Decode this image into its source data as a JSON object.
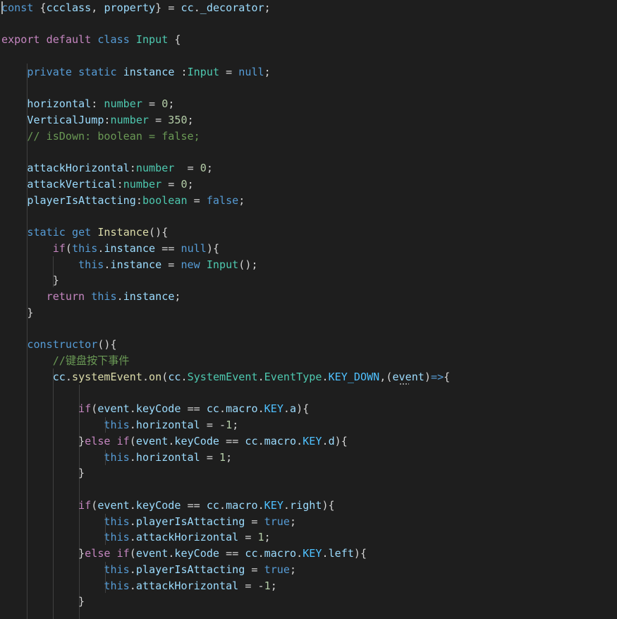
{
  "editor": {
    "language": "typescript",
    "theme": {
      "background": "#1e1e1e",
      "keyword": "#569cd6",
      "control": "#c586c0",
      "variable": "#9cdcfe",
      "type": "#4ec9b0",
      "function": "#dcdcaa",
      "number": "#b5cea8",
      "comment": "#6a9955",
      "plain": "#d4d4d4"
    },
    "lines": [
      [
        [
          "kw",
          "const"
        ],
        [
          "p",
          " {"
        ],
        [
          "v",
          "ccclass"
        ],
        [
          "p",
          ", "
        ],
        [
          "v",
          "property"
        ],
        [
          "p",
          "} = "
        ],
        [
          "v",
          "cc"
        ],
        [
          "p",
          "."
        ],
        [
          "v",
          "_decorator"
        ],
        [
          "p",
          ";"
        ]
      ],
      [],
      [
        [
          "ctl",
          "export"
        ],
        [
          "p",
          " "
        ],
        [
          "ctl",
          "default"
        ],
        [
          "p",
          " "
        ],
        [
          "kw",
          "class"
        ],
        [
          "p",
          " "
        ],
        [
          "t",
          "Input"
        ],
        [
          "p",
          " {"
        ]
      ],
      [],
      [
        [
          "p",
          "    "
        ],
        [
          "kw",
          "private"
        ],
        [
          "p",
          " "
        ],
        [
          "kw",
          "static"
        ],
        [
          "p",
          " "
        ],
        [
          "v",
          "instance"
        ],
        [
          "p",
          " :"
        ],
        [
          "t",
          "Input"
        ],
        [
          "p",
          " = "
        ],
        [
          "kw",
          "null"
        ],
        [
          "p",
          ";"
        ]
      ],
      [],
      [
        [
          "p",
          "    "
        ],
        [
          "v",
          "horizontal"
        ],
        [
          "p",
          ": "
        ],
        [
          "t",
          "number"
        ],
        [
          "p",
          " = "
        ],
        [
          "n",
          "0"
        ],
        [
          "p",
          ";"
        ]
      ],
      [
        [
          "p",
          "    "
        ],
        [
          "v",
          "VerticalJump"
        ],
        [
          "p",
          ":"
        ],
        [
          "t",
          "number"
        ],
        [
          "p",
          " = "
        ],
        [
          "n",
          "350"
        ],
        [
          "p",
          ";"
        ]
      ],
      [
        [
          "p",
          "    "
        ],
        [
          "c",
          "// isDown: boolean = false;"
        ]
      ],
      [],
      [
        [
          "p",
          "    "
        ],
        [
          "v",
          "attackHorizontal"
        ],
        [
          "p",
          ":"
        ],
        [
          "t",
          "number"
        ],
        [
          "p",
          "  = "
        ],
        [
          "n",
          "0"
        ],
        [
          "p",
          ";"
        ]
      ],
      [
        [
          "p",
          "    "
        ],
        [
          "v",
          "attackVertical"
        ],
        [
          "p",
          ":"
        ],
        [
          "t",
          "number"
        ],
        [
          "p",
          " = "
        ],
        [
          "n",
          "0"
        ],
        [
          "p",
          ";"
        ]
      ],
      [
        [
          "p",
          "    "
        ],
        [
          "v",
          "playerIsAttacting"
        ],
        [
          "p",
          ":"
        ],
        [
          "t",
          "boolean"
        ],
        [
          "p",
          " = "
        ],
        [
          "kw",
          "false"
        ],
        [
          "p",
          ";"
        ]
      ],
      [],
      [
        [
          "p",
          "    "
        ],
        [
          "kw",
          "static"
        ],
        [
          "p",
          " "
        ],
        [
          "kw",
          "get"
        ],
        [
          "p",
          " "
        ],
        [
          "fn",
          "Instance"
        ],
        [
          "p",
          "(){"
        ]
      ],
      [
        [
          "p",
          "        "
        ],
        [
          "ctl",
          "if"
        ],
        [
          "p",
          "("
        ],
        [
          "kw",
          "this"
        ],
        [
          "p",
          "."
        ],
        [
          "v",
          "instance"
        ],
        [
          "p",
          " == "
        ],
        [
          "kw",
          "null"
        ],
        [
          "p",
          "){"
        ]
      ],
      [
        [
          "p",
          "            "
        ],
        [
          "kw",
          "this"
        ],
        [
          "p",
          "."
        ],
        [
          "v",
          "instance"
        ],
        [
          "p",
          " = "
        ],
        [
          "kw",
          "new"
        ],
        [
          "p",
          " "
        ],
        [
          "t",
          "Input"
        ],
        [
          "p",
          "();"
        ]
      ],
      [
        [
          "p",
          "        }"
        ]
      ],
      [
        [
          "p",
          "       "
        ],
        [
          "ctl",
          "return"
        ],
        [
          "p",
          " "
        ],
        [
          "kw",
          "this"
        ],
        [
          "p",
          "."
        ],
        [
          "v",
          "instance"
        ],
        [
          "p",
          ";"
        ]
      ],
      [
        [
          "p",
          "    }"
        ]
      ],
      [],
      [
        [
          "p",
          "    "
        ],
        [
          "kw",
          "constructor"
        ],
        [
          "p",
          "(){"
        ]
      ],
      [
        [
          "p",
          "        "
        ],
        [
          "c",
          "//键盘按下事件"
        ]
      ],
      [
        [
          "p",
          "        "
        ],
        [
          "v",
          "cc"
        ],
        [
          "p",
          "."
        ],
        [
          "fn",
          "systemEvent"
        ],
        [
          "p",
          "."
        ],
        [
          "fn",
          "on"
        ],
        [
          "p",
          "("
        ],
        [
          "v",
          "cc"
        ],
        [
          "p",
          "."
        ],
        [
          "t",
          "SystemEvent"
        ],
        [
          "p",
          "."
        ],
        [
          "t",
          "EventType"
        ],
        [
          "p",
          "."
        ],
        [
          "e",
          "KEY_DOWN"
        ],
        [
          "p",
          ",("
        ],
        [
          "v",
          "event"
        ],
        [
          "p",
          ")"
        ],
        [
          "kw",
          "=>"
        ],
        [
          "p",
          "{"
        ]
      ],
      [],
      [
        [
          "p",
          "            "
        ],
        [
          "ctl",
          "if"
        ],
        [
          "p",
          "("
        ],
        [
          "v",
          "event"
        ],
        [
          "p",
          "."
        ],
        [
          "v",
          "keyCode"
        ],
        [
          "p",
          " == "
        ],
        [
          "v",
          "cc"
        ],
        [
          "p",
          "."
        ],
        [
          "v",
          "macro"
        ],
        [
          "p",
          "."
        ],
        [
          "e",
          "KEY"
        ],
        [
          "p",
          "."
        ],
        [
          "v",
          "a"
        ],
        [
          "p",
          "){"
        ]
      ],
      [
        [
          "p",
          "                "
        ],
        [
          "kw",
          "this"
        ],
        [
          "p",
          "."
        ],
        [
          "v",
          "horizontal"
        ],
        [
          "p",
          " = -"
        ],
        [
          "n",
          "1"
        ],
        [
          "p",
          ";"
        ]
      ],
      [
        [
          "p",
          "            }"
        ],
        [
          "ctl",
          "else"
        ],
        [
          "p",
          " "
        ],
        [
          "ctl",
          "if"
        ],
        [
          "p",
          "("
        ],
        [
          "v",
          "event"
        ],
        [
          "p",
          "."
        ],
        [
          "v",
          "keyCode"
        ],
        [
          "p",
          " == "
        ],
        [
          "v",
          "cc"
        ],
        [
          "p",
          "."
        ],
        [
          "v",
          "macro"
        ],
        [
          "p",
          "."
        ],
        [
          "e",
          "KEY"
        ],
        [
          "p",
          "."
        ],
        [
          "v",
          "d"
        ],
        [
          "p",
          "){"
        ]
      ],
      [
        [
          "p",
          "                "
        ],
        [
          "kw",
          "this"
        ],
        [
          "p",
          "."
        ],
        [
          "v",
          "horizontal"
        ],
        [
          "p",
          " = "
        ],
        [
          "n",
          "1"
        ],
        [
          "p",
          ";"
        ]
      ],
      [
        [
          "p",
          "            }"
        ]
      ],
      [],
      [
        [
          "p",
          "            "
        ],
        [
          "ctl",
          "if"
        ],
        [
          "p",
          "("
        ],
        [
          "v",
          "event"
        ],
        [
          "p",
          "."
        ],
        [
          "v",
          "keyCode"
        ],
        [
          "p",
          " == "
        ],
        [
          "v",
          "cc"
        ],
        [
          "p",
          "."
        ],
        [
          "v",
          "macro"
        ],
        [
          "p",
          "."
        ],
        [
          "e",
          "KEY"
        ],
        [
          "p",
          "."
        ],
        [
          "v",
          "right"
        ],
        [
          "p",
          "){"
        ]
      ],
      [
        [
          "p",
          "                "
        ],
        [
          "kw",
          "this"
        ],
        [
          "p",
          "."
        ],
        [
          "v",
          "playerIsAttacting"
        ],
        [
          "p",
          " = "
        ],
        [
          "kw",
          "true"
        ],
        [
          "p",
          ";"
        ]
      ],
      [
        [
          "p",
          "                "
        ],
        [
          "kw",
          "this"
        ],
        [
          "p",
          "."
        ],
        [
          "v",
          "attackHorizontal"
        ],
        [
          "p",
          " = "
        ],
        [
          "n",
          "1"
        ],
        [
          "p",
          ";"
        ]
      ],
      [
        [
          "p",
          "            }"
        ],
        [
          "ctl",
          "else"
        ],
        [
          "p",
          " "
        ],
        [
          "ctl",
          "if"
        ],
        [
          "p",
          "("
        ],
        [
          "v",
          "event"
        ],
        [
          "p",
          "."
        ],
        [
          "v",
          "keyCode"
        ],
        [
          "p",
          " == "
        ],
        [
          "v",
          "cc"
        ],
        [
          "p",
          "."
        ],
        [
          "v",
          "macro"
        ],
        [
          "p",
          "."
        ],
        [
          "e",
          "KEY"
        ],
        [
          "p",
          "."
        ],
        [
          "v",
          "left"
        ],
        [
          "p",
          "){"
        ]
      ],
      [
        [
          "p",
          "                "
        ],
        [
          "kw",
          "this"
        ],
        [
          "p",
          "."
        ],
        [
          "v",
          "playerIsAttacting"
        ],
        [
          "p",
          " = "
        ],
        [
          "kw",
          "true"
        ],
        [
          "p",
          ";"
        ]
      ],
      [
        [
          "p",
          "                "
        ],
        [
          "kw",
          "this"
        ],
        [
          "p",
          "."
        ],
        [
          "v",
          "attackHorizontal"
        ],
        [
          "p",
          " = -"
        ],
        [
          "n",
          "1"
        ],
        [
          "p",
          ";"
        ]
      ],
      [
        [
          "p",
          "            }"
        ]
      ],
      []
    ]
  }
}
